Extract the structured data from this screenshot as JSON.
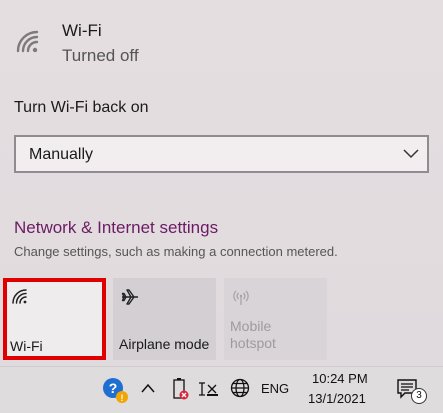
{
  "wifi_status": {
    "name": "Wi-Fi",
    "state": "Turned off"
  },
  "turn_back_on": {
    "label": "Turn Wi-Fi back on",
    "selected": "Manually"
  },
  "network_settings": {
    "link": "Network & Internet settings",
    "description": "Change settings, such as making a connection metered."
  },
  "quick_actions": [
    {
      "label": "Wi-Fi",
      "icon": "wifi-icon",
      "state": "off",
      "highlighted": true
    },
    {
      "label": "Airplane mode",
      "icon": "airplane-icon",
      "state": "off"
    },
    {
      "label": "Mobile\nhotspot",
      "icon": "mobile-hotspot-icon",
      "state": "disabled"
    }
  ],
  "taskbar": {
    "icons": [
      "help-icon",
      "chevron-up-icon",
      "battery-icon",
      "network-off-icon",
      "globe-icon"
    ],
    "language": "ENG",
    "time": "10:24 PM",
    "date": "13/1/2021",
    "notification_count": "3"
  },
  "colors": {
    "link": "#6b1b63",
    "highlight_border": "#e00000"
  }
}
